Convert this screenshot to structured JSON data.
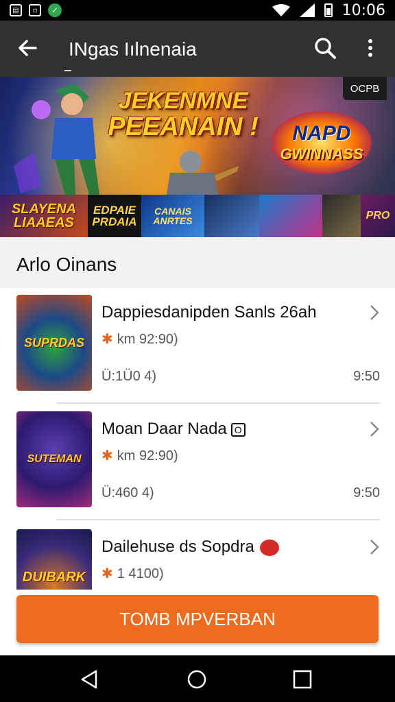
{
  "status_bar": {
    "time": "10:06",
    "icons": [
      "sim-icon",
      "notification-icon",
      "check-icon",
      "wifi-icon",
      "signal-icon",
      "battery-icon"
    ]
  },
  "app_bar": {
    "title": "INgas Iılnenaia",
    "icons": [
      "back-arrow-icon",
      "search-icon",
      "more-vert-icon"
    ]
  },
  "hero": {
    "headline_line1": "JEKENMNE",
    "headline_line2": "PEEANAIN !",
    "badge_top": "NAPD",
    "badge_bottom": "GWINNASS",
    "corner_tag": "OCPB"
  },
  "thumb_strip": [
    "SLAYENA LIAAEAS",
    "EDPAIE PRDAIA",
    "CANAIS ANRTES",
    "",
    "",
    "",
    "PRO"
  ],
  "section": {
    "title": "Arlo Oinans"
  },
  "list": [
    {
      "title": "Dappiesdanipden Sanls 26ah",
      "sub": "km 92:90)",
      "meta": "Ü:1Ü0 4)",
      "time": "9:50",
      "thumb_text": "SUPRDAS"
    },
    {
      "title": "Moan Daar Nada",
      "title_badge": "O",
      "sub": "km 92:90)",
      "meta": "Ü:460 4)",
      "time": "9:50",
      "thumb_text": "SUTEMAN"
    },
    {
      "title": "Dailehuse ds Sopdra",
      "sub": "1 4100)",
      "meta": "",
      "time": "",
      "thumb_text": "DUIBARK"
    }
  ],
  "cta": {
    "label": "TOMB MPVERBAN"
  },
  "colors": {
    "accent": "#ec6b1e",
    "app_bar": "#2f3133",
    "status_bar": "#000000"
  }
}
